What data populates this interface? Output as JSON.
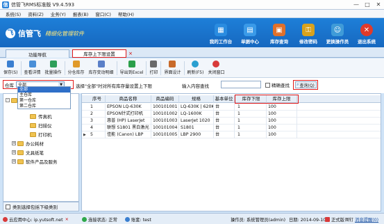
{
  "window": {
    "title": "信管飞RMS标准版 V9.4.593",
    "min": "—",
    "max": "□",
    "close": "✕"
  },
  "menubar": [
    "系统(S)",
    "资料(Z)",
    "业务(Y)",
    "报表(B)",
    "窗口(C)",
    "帮助(H)"
  ],
  "banner": {
    "logo_mark": "飞",
    "brand": "信管飞",
    "slogan": "精细化管理软件",
    "nav": [
      {
        "label": "我的工作台",
        "icon": "desk-icon",
        "color": "#2a8ce0"
      },
      {
        "label": "单据中心",
        "icon": "doc-icon",
        "color": "#3a9ae8"
      },
      {
        "label": "库存查询",
        "icon": "stock-icon",
        "color": "#e0702a"
      },
      {
        "label": "修改密码",
        "icon": "lock-icon",
        "color": "#d9a21c"
      },
      {
        "label": "更换操作员",
        "icon": "user-switch-icon",
        "color": "#3f9bd8"
      },
      {
        "label": "退出系统",
        "icon": "exit-icon",
        "color": "#e03a2a"
      }
    ]
  },
  "tabs": {
    "home": "功能导航",
    "active": "库存上下限设置",
    "close": "×"
  },
  "toolbar": [
    {
      "label": "保存(S)",
      "icon": "save-icon",
      "color": "#3a7fd0"
    },
    {
      "label": "查看详情",
      "icon": "details-icon",
      "color": "#4a8fd8"
    },
    {
      "label": "批量操作",
      "icon": "batch-icon",
      "color": "#2e9f5a"
    },
    {
      "label": "分仓库存",
      "icon": "warehouse-icon",
      "color": "#e09a2a"
    },
    {
      "label": "库存变动明细",
      "icon": "change-detail-icon",
      "color": "#5a7fc8"
    },
    {
      "label": "导出到Excel",
      "icon": "excel-icon",
      "color": "#2a9f4a"
    },
    {
      "label": "打印",
      "icon": "print-icon",
      "color": "#6a6a6a"
    },
    {
      "label": "界面设计",
      "icon": "design-icon",
      "color": "#c86a2a"
    },
    {
      "label": "刷新(F5)",
      "icon": "refresh-icon",
      "color": "#2a9fd0"
    },
    {
      "label": "关闭窗口",
      "icon": "close-window-icon",
      "color": "#d83a3a"
    }
  ],
  "filter": {
    "warehouse_label": "仓库",
    "warehouse_value": "全部",
    "hint": "选择\"全部\"时对所有库存量设置上下限",
    "search_label": "输入内容查找",
    "search_value": "",
    "exact_label": "精确查找",
    "query_label": "查询(Q)"
  },
  "dropdown_options": [
    "全部",
    "主仓库",
    "第一仓库",
    "第二仓库"
  ],
  "tree": {
    "root": "商品",
    "items": [
      "传真机",
      "扫描仪",
      "打印机",
      "办公耗材",
      "文具纸笔",
      "软件产品及服务"
    ],
    "footer": "类别选择包括下级类别"
  },
  "grid": {
    "columns": [
      "序号",
      "商品名称",
      "商品编码",
      "规格",
      "基本单位",
      "库存下限",
      "库存上限"
    ],
    "rows": [
      [
        "1",
        "EPSON LQ-630K",
        "100101001",
        "LQ-630K | 620K",
        "台",
        "1",
        "100"
      ],
      [
        "2",
        "EPSON针式打印机",
        "100101002",
        "LQ-1600K",
        "台",
        "1",
        "100"
      ],
      [
        "3",
        "惠普 (HP) LaserJet",
        "100101003",
        "LaserJet 1020",
        "台",
        "1",
        "100"
      ],
      [
        "4",
        "联想 S1801 黑白激光",
        "100101004",
        "S1801",
        "台",
        "1",
        "100"
      ],
      [
        "5",
        "佳能 (Canon) LBP",
        "100101005",
        "LBP 2900",
        "台",
        "1",
        "100"
      ]
    ]
  },
  "status": {
    "cloud": "云应用中心: ip.yutsoft.net",
    "cloud_close": "×",
    "conn": "连接状态: 正常",
    "account": "账套: test",
    "operator": "操作员: 系统管理员(admin)",
    "date": "日期: 2014-09-10",
    "edition": "正式版",
    "pin": "图钉",
    "msg": "消息提醒(0)"
  }
}
